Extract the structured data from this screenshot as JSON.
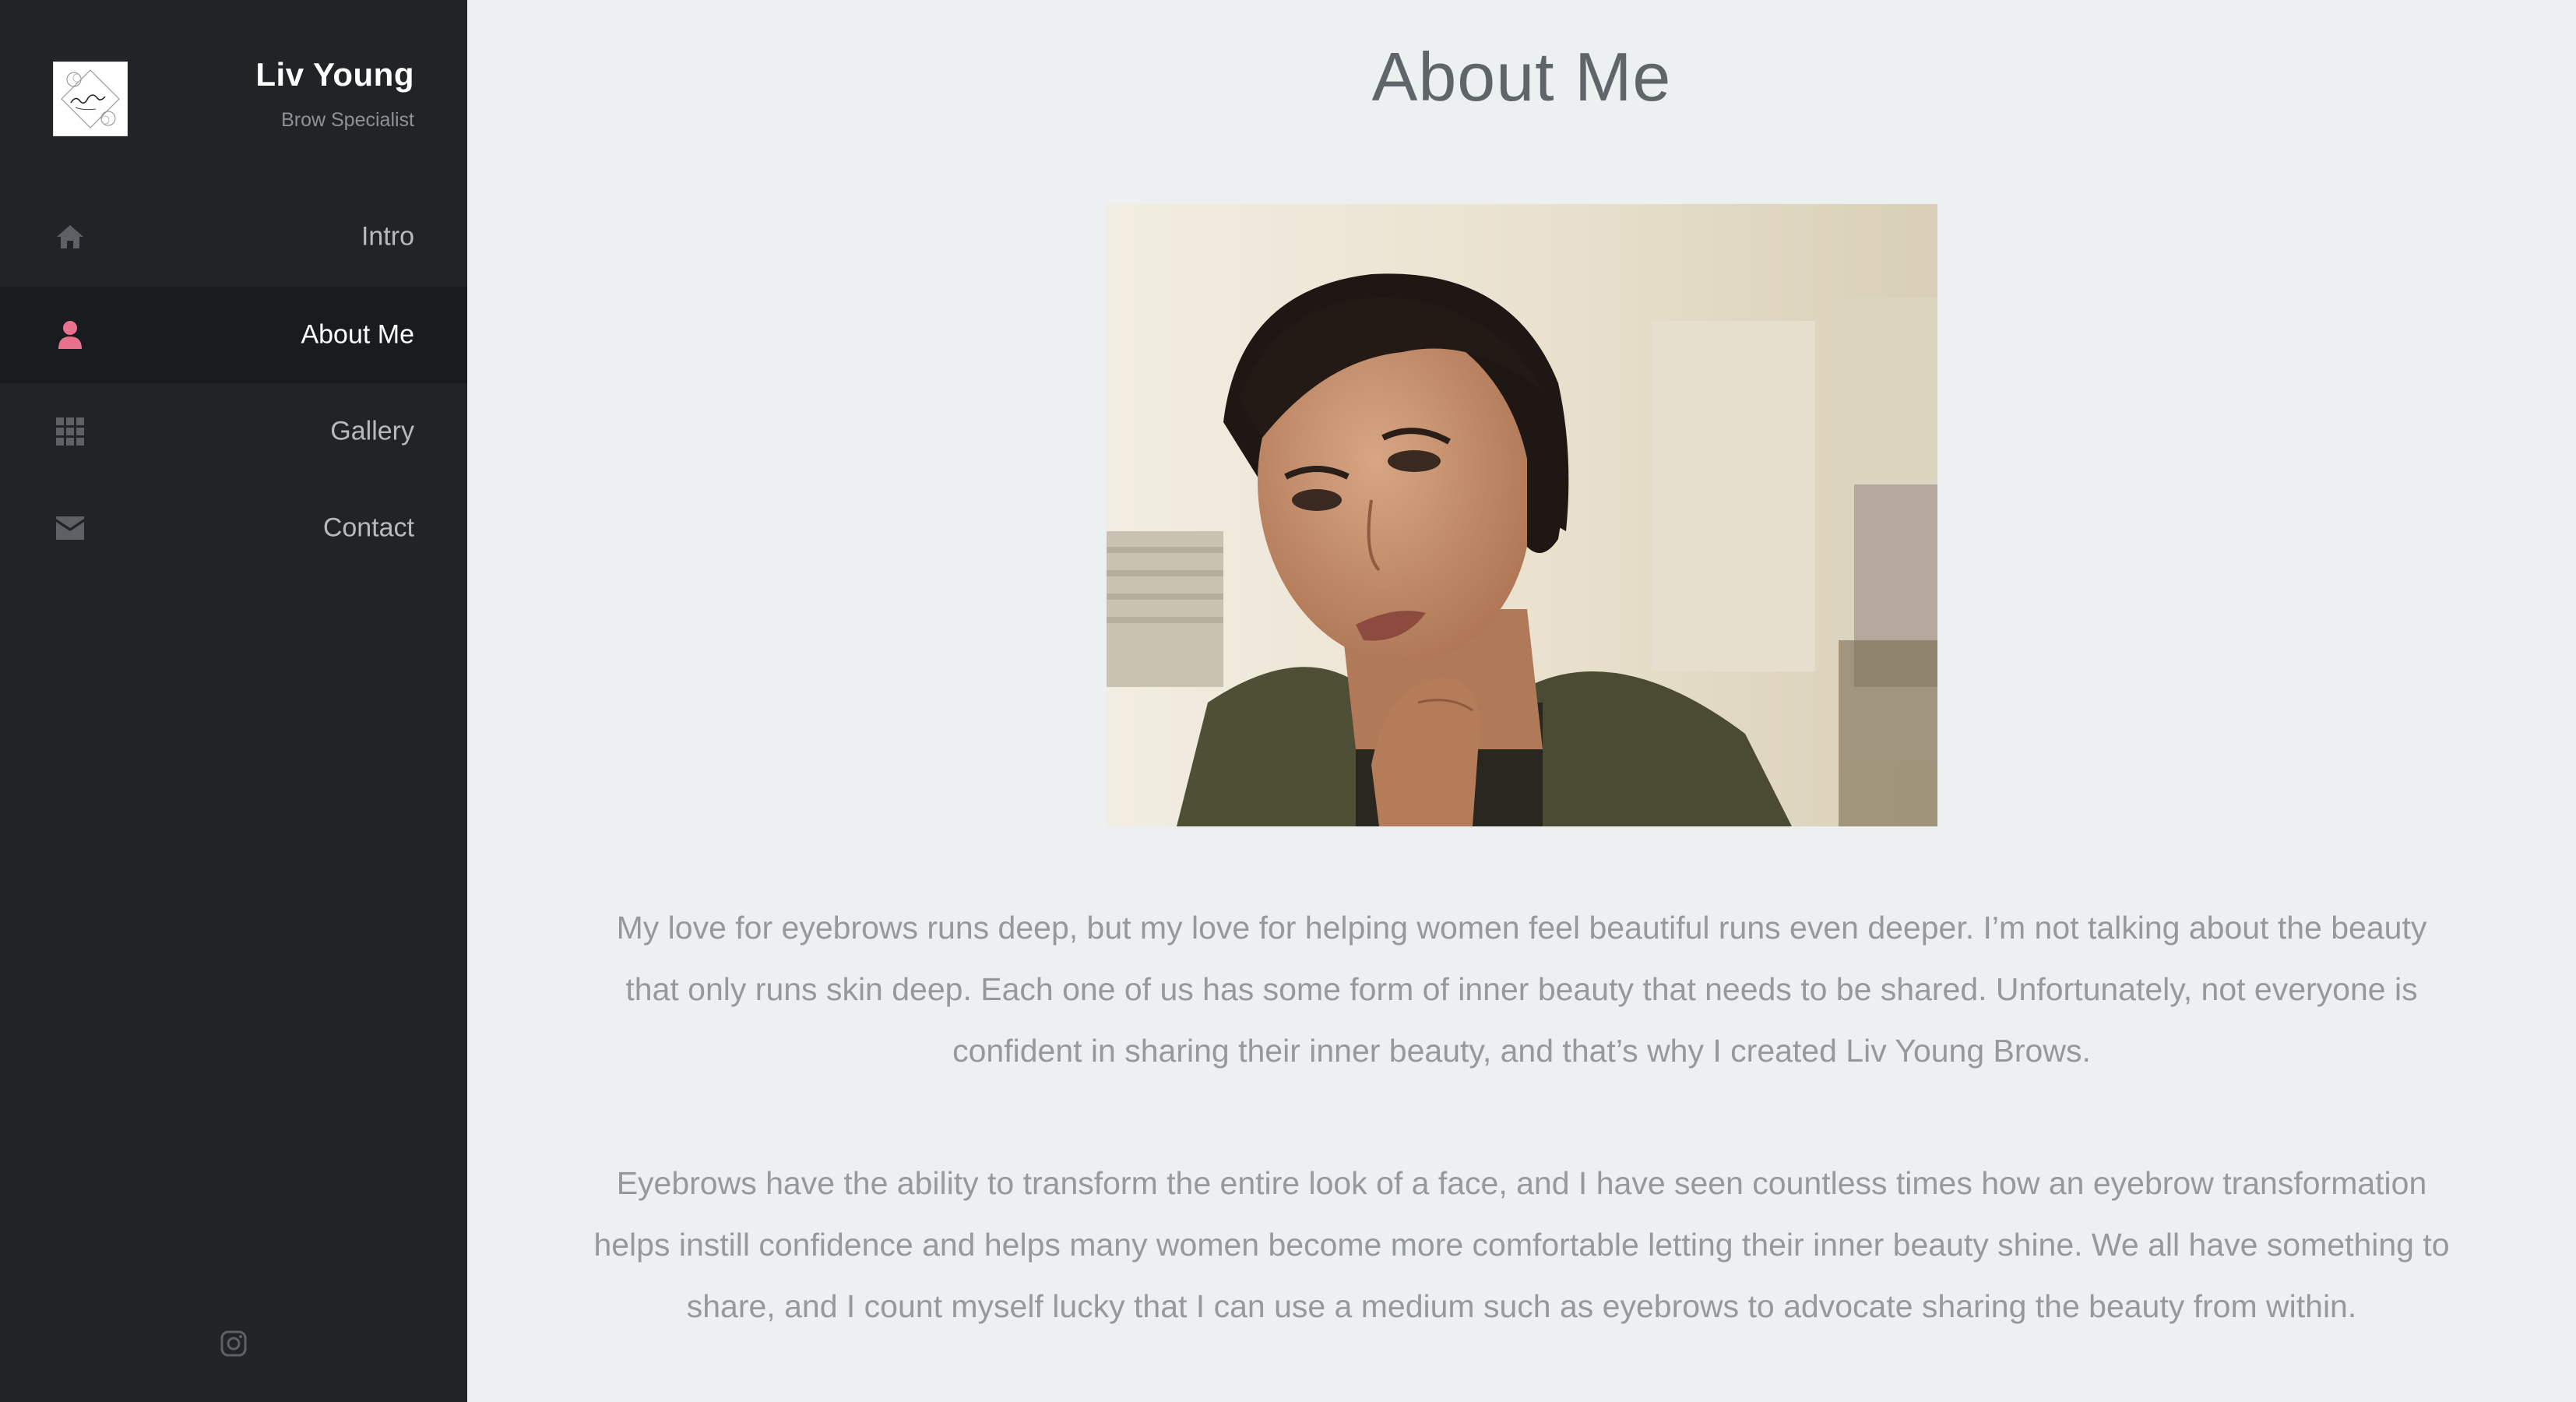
{
  "sidebar": {
    "brand_name": "Liv Young",
    "brand_subtitle": "Brow Specialist",
    "items": [
      {
        "label": "Intro",
        "icon": "home-icon"
      },
      {
        "label": "About Me",
        "icon": "user-icon",
        "active": true
      },
      {
        "label": "Gallery",
        "icon": "grid-icon"
      },
      {
        "label": "Contact",
        "icon": "envelope-icon"
      }
    ],
    "social_icon": "instagram-icon"
  },
  "main": {
    "title": "About Me",
    "paragraphs": [
      "My love for eyebrows runs deep, but my love for helping women feel beautiful runs even deeper. I’m not talking about the beauty that only runs skin deep. Each one of us has some form of inner beauty that needs to be shared. Unfortunately, not everyone is confident in sharing their inner beauty, and that’s why I created Liv Young Brows.",
      "Eyebrows have the ability to transform the entire look of a face, and I have seen countless times how an eyebrow transformation helps instill confidence and helps many women become more comfortable letting their inner beauty shine. We all have something to share, and I count myself lucky that I can use a medium such as eyebrows to advocate sharing the beauty from within."
    ]
  },
  "colors": {
    "sidebar_bg": "#202427",
    "sidebar_active_bg": "#191c1f",
    "accent": "#e8728d",
    "icon_muted": "#5d6166",
    "page_bg": "#ecf0f0"
  }
}
